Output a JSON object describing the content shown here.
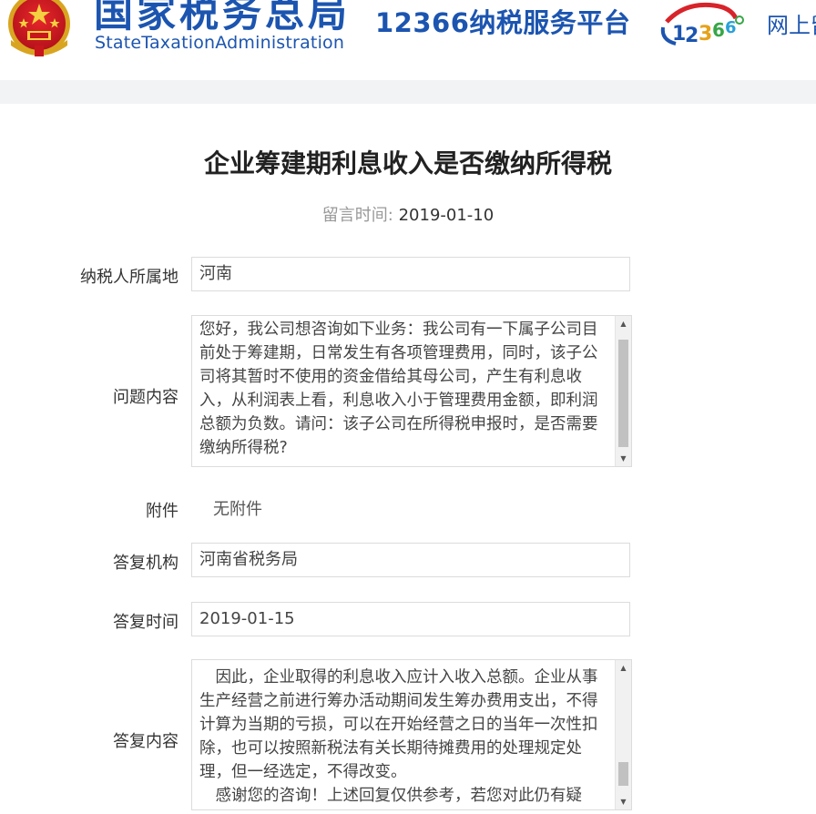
{
  "header": {
    "brand_cn": "国家税务总局",
    "brand_en": "StateTaxationAdministration",
    "platform": "12366纳税服务平台",
    "online": "网上留",
    "brand_color": "#1c55b0"
  },
  "page": {
    "title": "企业筹建期利息收入是否缴纳所得税",
    "post_time_label": "留言时间:",
    "post_time": "2019-01-10"
  },
  "form": {
    "region_label": "纳税人所属地",
    "region_value": "河南",
    "question_label": "问题内容",
    "question_text": "您好，我公司想咨询如下业务：我公司有一下属子公司目前处于筹建期，日常发生有各项管理费用，同时，该子公司将其暂时不使用的资金借给其母公司，产生有利息收入，从利润表上看，利息收入小于管理费用金额，即利润总额为负数。请问：该子公司在所得税申报时，是否需要缴纳所得税?",
    "attachment_label": "附件",
    "attachment_value": "无附件",
    "agency_label": "答复机构",
    "agency_value": "河南省税务局",
    "reply_time_label": "答复时间",
    "reply_time_value": "2019-01-15",
    "reply_label": "答复内容",
    "reply_paragraphs": [
      "　因此，企业取得的利息收入应计入收入总额。企业从事生产经营之前进行筹办活动期间发生筹办费用支出，不得计算为当期的亏损，可以在开始经营之日的当年一次性扣除，也可以按照新税法有关长期待摊费用的处理规定处理，但一经选定，不得改变。",
      "　感谢您的咨询！上述回复仅供参考，若您对此仍有疑"
    ]
  }
}
